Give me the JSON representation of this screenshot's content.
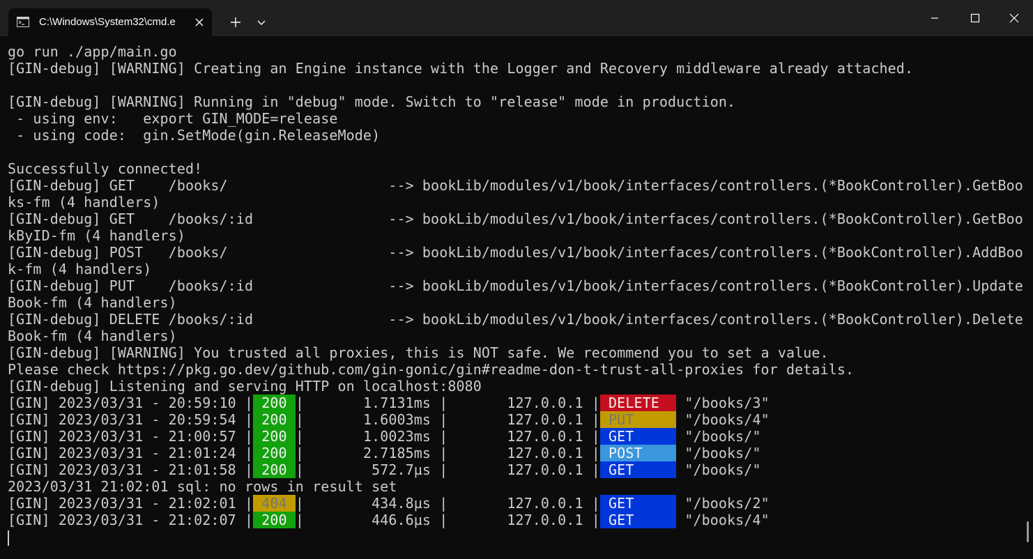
{
  "window": {
    "tab_title": "C:\\Windows\\System32\\cmd.e",
    "icons": {
      "tab_icon": "terminal-icon",
      "tab_close": "close-icon",
      "new_tab": "plus-icon",
      "dropdown": "chevron-down-icon",
      "minimize": "minimize-icon",
      "maximize": "maximize-icon",
      "close": "close-icon"
    }
  },
  "colors": {
    "terminal_bg": "#0c0c0c",
    "terminal_fg": "#cccccc",
    "titlebar_bg": "#202020",
    "badge_green": "#13a10e",
    "badge_yellow": "#c19c00",
    "badge_red": "#c50f1f",
    "badge_blue": "#0037da",
    "badge_cyan": "#3a96dd"
  },
  "terminal": {
    "lines": [
      [
        {
          "t": "go run ./app/main.go"
        }
      ],
      [
        {
          "t": "[GIN-debug] [WARNING] Creating an Engine instance with the Logger and Recovery middleware already attached."
        }
      ],
      [
        {
          "t": ""
        }
      ],
      [
        {
          "t": "[GIN-debug] [WARNING] Running in \"debug\" mode. Switch to \"release\" mode in production."
        }
      ],
      [
        {
          "t": " - using env:   export GIN_MODE=release"
        }
      ],
      [
        {
          "t": " - using code:  gin.SetMode(gin.ReleaseMode)"
        }
      ],
      [
        {
          "t": ""
        }
      ],
      [
        {
          "t": "Successfully connected!"
        }
      ],
      [
        {
          "t": "[GIN-debug] GET    /books/                   --> bookLib/modules/v1/book/interfaces/controllers.(*BookController).GetBoo"
        }
      ],
      [
        {
          "t": "ks-fm (4 handlers)"
        }
      ],
      [
        {
          "t": "[GIN-debug] GET    /books/:id                --> bookLib/modules/v1/book/interfaces/controllers.(*BookController).GetBoo"
        }
      ],
      [
        {
          "t": "kByID-fm (4 handlers)"
        }
      ],
      [
        {
          "t": "[GIN-debug] POST   /books/                   --> bookLib/modules/v1/book/interfaces/controllers.(*BookController).AddBoo"
        }
      ],
      [
        {
          "t": "k-fm (4 handlers)"
        }
      ],
      [
        {
          "t": "[GIN-debug] PUT    /books/:id                --> bookLib/modules/v1/book/interfaces/controllers.(*BookController).Update"
        }
      ],
      [
        {
          "t": "Book-fm (4 handlers)"
        }
      ],
      [
        {
          "t": "[GIN-debug] DELETE /books/:id                --> bookLib/modules/v1/book/interfaces/controllers.(*BookController).Delete"
        }
      ],
      [
        {
          "t": "Book-fm (4 handlers)"
        }
      ],
      [
        {
          "t": "[GIN-debug] [WARNING] You trusted all proxies, this is NOT safe. We recommend you to set a value."
        }
      ],
      [
        {
          "t": "Please check https://pkg.go.dev/github.com/gin-gonic/gin#readme-don-t-trust-all-proxies for details."
        }
      ],
      [
        {
          "t": "[GIN-debug] Listening and serving HTTP on localhost:8080"
        }
      ],
      [
        {
          "t": "[GIN] 2023/03/31 - 20:59:10 |"
        },
        {
          "t": " 200 ",
          "c": "b-green"
        },
        {
          "t": "|       1.7131ms |       127.0.0.1 |"
        },
        {
          "t": " DELETE  ",
          "c": "b-red"
        },
        {
          "t": " \"/books/3\""
        }
      ],
      [
        {
          "t": "[GIN] 2023/03/31 - 20:59:54 |"
        },
        {
          "t": " 200 ",
          "c": "b-green"
        },
        {
          "t": "|       1.6003ms |       127.0.0.1 |"
        },
        {
          "t": " PUT     ",
          "c": "b-yellow"
        },
        {
          "t": " \"/books/4\""
        }
      ],
      [
        {
          "t": "[GIN] 2023/03/31 - 21:00:57 |"
        },
        {
          "t": " 200 ",
          "c": "b-green"
        },
        {
          "t": "|       1.0023ms |       127.0.0.1 |"
        },
        {
          "t": " GET     ",
          "c": "b-blue"
        },
        {
          "t": " \"/books/\""
        }
      ],
      [
        {
          "t": "[GIN] 2023/03/31 - 21:01:24 |"
        },
        {
          "t": " 200 ",
          "c": "b-green"
        },
        {
          "t": "|       2.7185ms |       127.0.0.1 |"
        },
        {
          "t": " POST    ",
          "c": "b-cyan"
        },
        {
          "t": " \"/books/\""
        }
      ],
      [
        {
          "t": "[GIN] 2023/03/31 - 21:01:58 |"
        },
        {
          "t": " 200 ",
          "c": "b-green"
        },
        {
          "t": "|        572.7µs |       127.0.0.1 |"
        },
        {
          "t": " GET     ",
          "c": "b-blue"
        },
        {
          "t": " \"/books/\""
        }
      ],
      [
        {
          "t": "2023/03/31 21:02:01 sql: no rows in result set"
        }
      ],
      [
        {
          "t": "[GIN] 2023/03/31 - 21:02:01 |"
        },
        {
          "t": " 404 ",
          "c": "b-yellow"
        },
        {
          "t": "|        434.8µs |       127.0.0.1 |"
        },
        {
          "t": " GET     ",
          "c": "b-blue"
        },
        {
          "t": " \"/books/2\""
        }
      ],
      [
        {
          "t": "[GIN] 2023/03/31 - 21:02:07 |"
        },
        {
          "t": " 200 ",
          "c": "b-green"
        },
        {
          "t": "|        446.6µs |       127.0.0.1 |"
        },
        {
          "t": " GET     ",
          "c": "b-blue"
        },
        {
          "t": " \"/books/4\""
        }
      ]
    ]
  }
}
